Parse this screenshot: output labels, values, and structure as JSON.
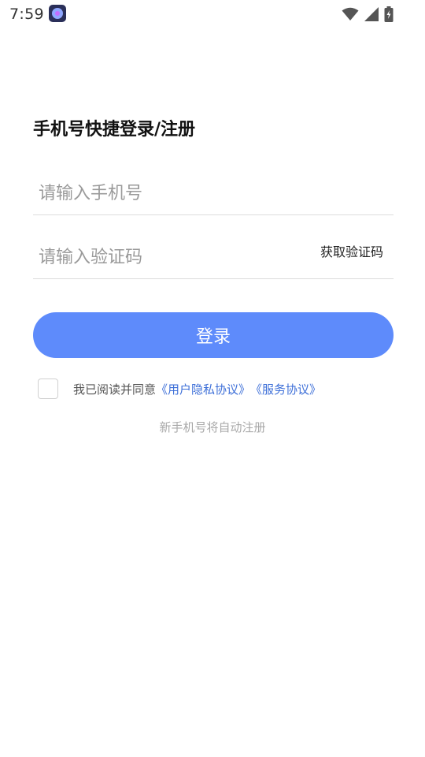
{
  "status_bar": {
    "time": "7:59",
    "app_icon": "app-notification-icon",
    "icons": [
      "wifi-icon",
      "signal-icon",
      "battery-charging-icon"
    ]
  },
  "login": {
    "title": "手机号快捷登录/注册",
    "phone_placeholder": "请输入手机号",
    "phone_value": "",
    "code_placeholder": "请输入验证码",
    "code_value": "",
    "get_code_label": "获取验证码",
    "login_label": "登录",
    "agreement_prefix": "我已阅读并同意",
    "privacy_link": "《用户隐私协议》",
    "service_link": "《服务协议》",
    "agreement_checked": false,
    "new_user_hint": "新手机号将自动注册"
  },
  "colors": {
    "primary_button": "#5e8bfb",
    "link": "#3d6fd8",
    "hint_text": "#a8a8a8",
    "divider": "#dcdcdc"
  }
}
